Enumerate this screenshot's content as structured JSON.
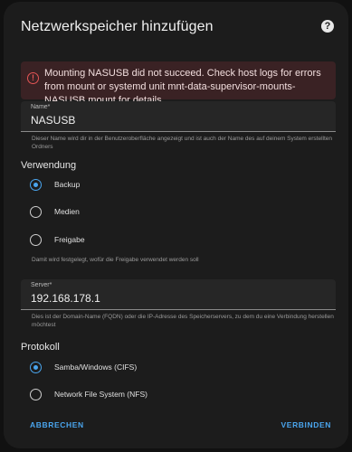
{
  "dialog": {
    "title": "Netzwerkspeicher hinzufügen",
    "help_icon": "help-circle-icon"
  },
  "alert": {
    "icon": "alert-circle-icon",
    "message": "Mounting NASUSB did not succeed. Check host logs for errors from mount or systemd unit mnt-data-supervisor-mounts-NASUSB.mount for details.",
    "color": "#e45555"
  },
  "name_field": {
    "label": "Name*",
    "value": "NASUSB",
    "helper": "Dieser Name wird dir in der Benutzeroberfläche angezeigt und ist auch der Name des auf deinem System erstellten Ordners"
  },
  "usage": {
    "title": "Verwendung",
    "options": [
      {
        "label": "Backup",
        "checked": true
      },
      {
        "label": "Medien",
        "checked": false
      },
      {
        "label": "Freigabe",
        "checked": false
      }
    ],
    "helper": "Damit wird festgelegt, wofür die Freigabe verwendet werden soll"
  },
  "server_field": {
    "label": "Server*",
    "value": "192.168.178.1",
    "helper": "Dies ist der Domain-Name (FQDN) oder die IP-Adresse des Speicherservers, zu dem du eine Verbindung herstellen möchtest"
  },
  "protocol": {
    "title": "Protokoll",
    "options": [
      {
        "label": "Samba/Windows (CIFS)",
        "checked": true
      },
      {
        "label": "Network File System (NFS)",
        "checked": false
      }
    ]
  },
  "footer": {
    "cancel_label": "ABBRECHEN",
    "connect_label": "VERBINDEN"
  },
  "colors": {
    "accent": "#4aa5ee",
    "surface": "#1c1c1c",
    "error": "#e45555"
  }
}
